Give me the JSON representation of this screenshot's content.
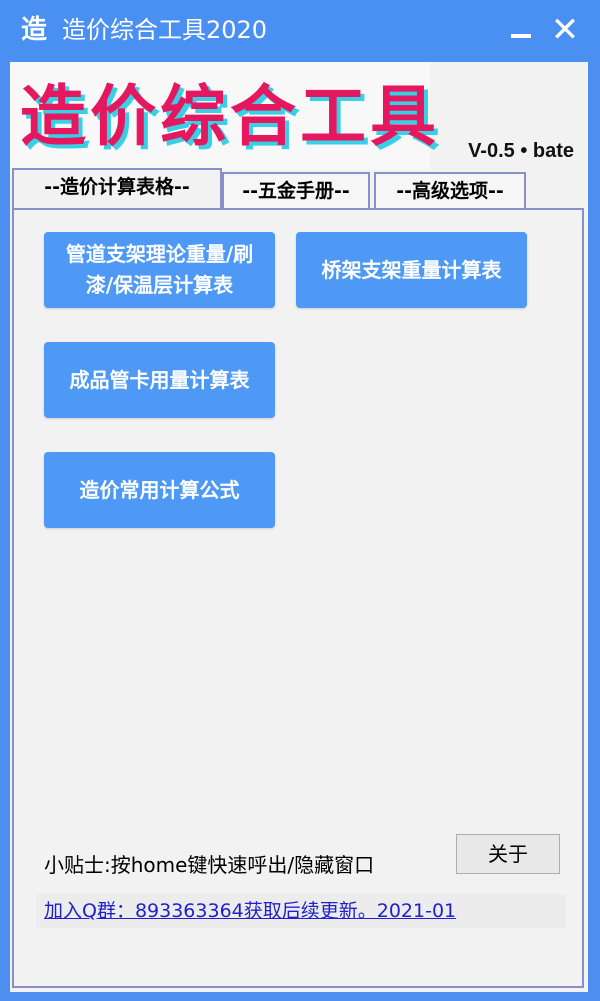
{
  "window": {
    "icon_char": "造",
    "title": "造价综合工具2020",
    "minimize_label": "",
    "close_label": "✕"
  },
  "header": {
    "logo_text": "造价综合工具",
    "version": "V-0.5 • bate"
  },
  "tabs": [
    {
      "label": "--造价计算表格--",
      "active": true
    },
    {
      "label": "--五金手册--",
      "active": false
    },
    {
      "label": "--高级选项--",
      "active": false
    }
  ],
  "buttons": {
    "pipe_support_line1": "管道支架理论重量/刷",
    "pipe_support_line2": "漆/保温层计算表",
    "bridge_support": "桥架支架重量计算表",
    "pipe_clamp": "成品管卡用量计算表",
    "formulas": "造价常用计算公式"
  },
  "footer": {
    "tip": "小贴士:按home键快速呼出/隐藏窗口",
    "about_label": "关于",
    "qq_link": "加入Q群：893363364获取后续更新。2021-01"
  },
  "colors": {
    "titlebar": "#4a8ff2",
    "button_bg": "#4d99f5",
    "logo_red": "#e5185f",
    "logo_cyan": "#37d0e6",
    "link": "#1f1fcf"
  }
}
